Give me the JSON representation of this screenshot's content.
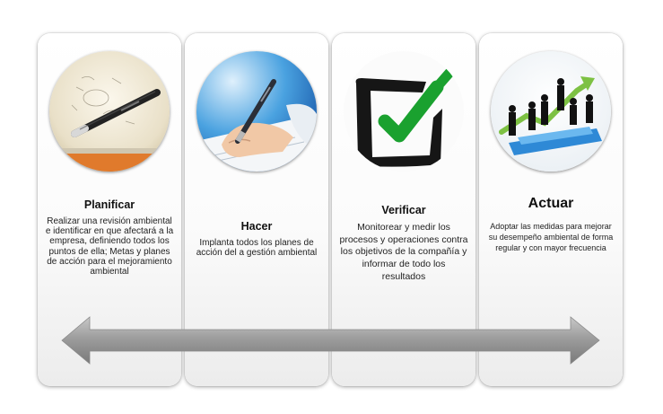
{
  "steps": [
    {
      "title": "Planificar",
      "description": "Realizar una revisión ambiental e identificar en que afectará a la empresa, definiendo todos los puntos de ella; Metas y planes de acción para el mejoramiento ambiental",
      "icon": "pen-on-paper-icon"
    },
    {
      "title": "Hacer",
      "description": "Implanta todos los planes de acción del a gestión ambiental",
      "icon": "writing-hand-icon"
    },
    {
      "title": "Verificar",
      "description": "Monitorear y medir los procesos y operaciones contra los objetivos de la compañía y informar de todo los resultados",
      "icon": "checkmark-box-icon"
    },
    {
      "title": "Actuar",
      "description": "Adoptar las medidas para mejorar su desempeño ambiental de forma regular y con mayor frecuencia",
      "icon": "business-growth-icon"
    }
  ],
  "arrow": {
    "icon": "double-headed-arrow-icon",
    "color": "#9a9a9a"
  }
}
